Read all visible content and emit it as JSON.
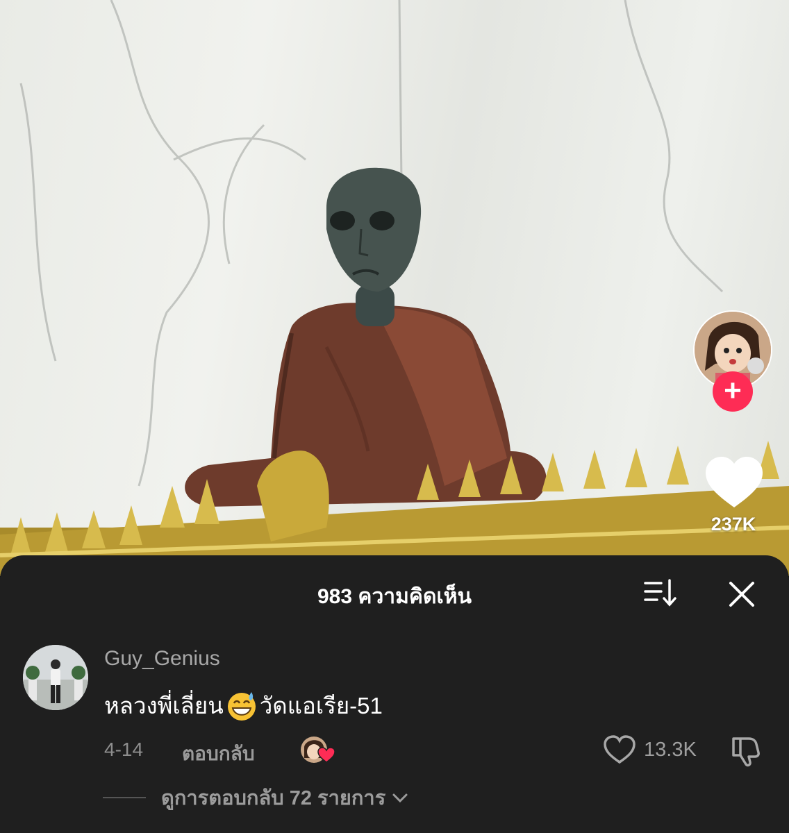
{
  "video": {
    "like_count": "237K",
    "creator_avatar_icon": "creator-avatar-icon",
    "follow_icon": "plus-icon"
  },
  "comments_panel": {
    "title": "983 ความคิดเห็น",
    "sort_icon": "sort-icon",
    "close_icon": "close-icon"
  },
  "comment": {
    "username": "Guy_Genius",
    "text_before": "หลวงพี่เลี่ยน",
    "emoji": "grinning-sweat-emoji",
    "text_after": "วัดแอเรีย-51",
    "date": "4-14",
    "reply_label": "ตอบกลับ",
    "like_count": "13.3K",
    "view_replies": "ดูการตอบกลับ 72 รายการ"
  },
  "colors": {
    "sheet_bg": "#1f1f1f",
    "accent": "#fe2c55",
    "wall": "#eceee9"
  }
}
